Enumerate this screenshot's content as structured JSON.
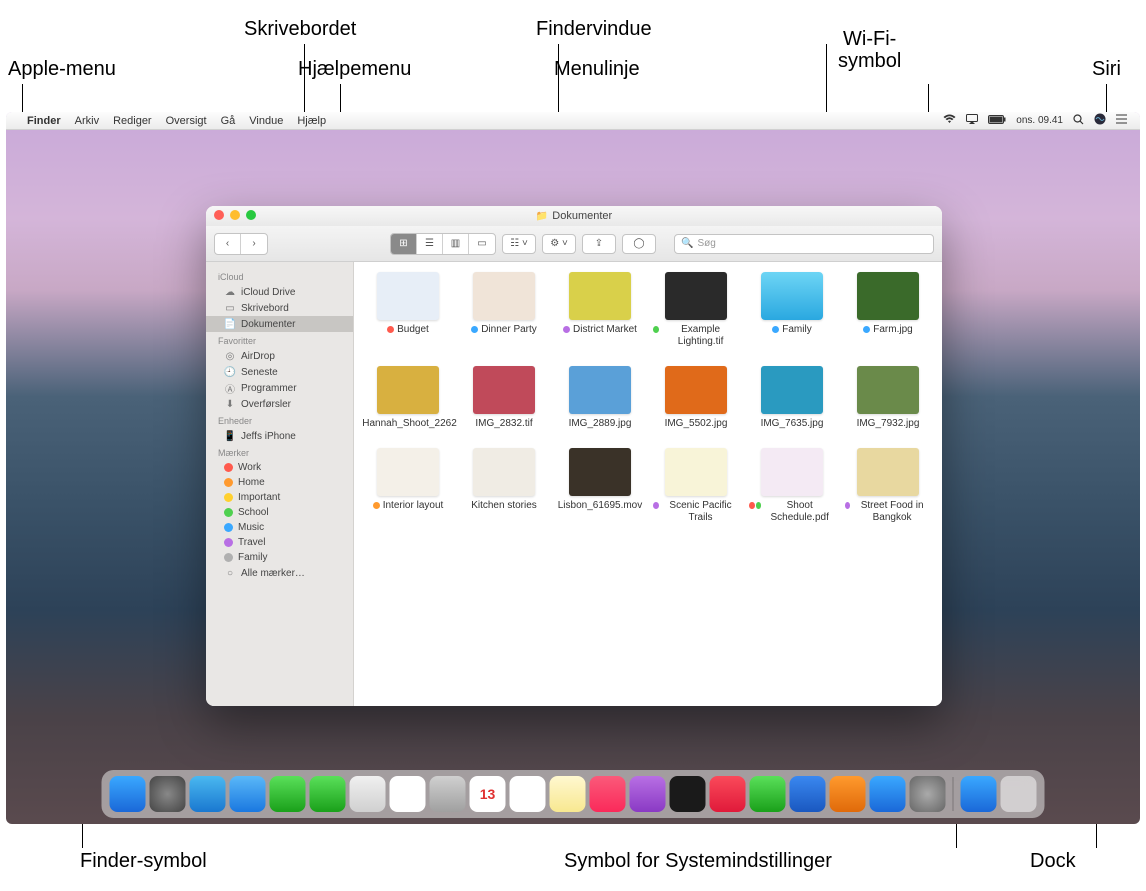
{
  "callouts": {
    "apple_menu": "Apple-menu",
    "desktop": "Skrivebordet",
    "help_menu": "Hjælpemenu",
    "finder_window": "Findervindue",
    "menu_bar": "Menulinje",
    "wifi": "Wi-Fi-\nsymbol",
    "wifi_l1": "Wi-Fi-",
    "wifi_l2": "symbol",
    "siri": "Siri",
    "finder_icon": "Finder-symbol",
    "sysprefs_icon": "Symbol for Systemindstillinger",
    "dock": "Dock"
  },
  "menubar": {
    "apple": "",
    "app": "Finder",
    "items": [
      "Arkiv",
      "Rediger",
      "Oversigt",
      "Gå",
      "Vindue",
      "Hjælp"
    ],
    "clock": "ons. 09.41"
  },
  "finder": {
    "title": "Dokumenter",
    "search_placeholder": "Søg",
    "sidebar": {
      "icloud_heading": "iCloud",
      "icloud": [
        "iCloud Drive",
        "Skrivebord",
        "Dokumenter"
      ],
      "fav_heading": "Favoritter",
      "fav": [
        "AirDrop",
        "Seneste",
        "Programmer",
        "Overførsler"
      ],
      "dev_heading": "Enheder",
      "dev": [
        "Jeffs iPhone"
      ],
      "tags_heading": "Mærker",
      "tags": [
        {
          "label": "Work",
          "color": "#ff5a4d"
        },
        {
          "label": "Home",
          "color": "#ff9a2e"
        },
        {
          "label": "Important",
          "color": "#ffd02e"
        },
        {
          "label": "School",
          "color": "#4fd04f"
        },
        {
          "label": "Music",
          "color": "#3aa8ff"
        },
        {
          "label": "Travel",
          "color": "#b86fe4"
        },
        {
          "label": "Family",
          "color": "#b0b0b0"
        }
      ],
      "all_tags": "Alle mærker…"
    },
    "files": [
      {
        "name": "Budget",
        "tag": "#ff5a4d",
        "thumb": "#e7eef7"
      },
      {
        "name": "Dinner Party",
        "tag": "#3aa8ff",
        "thumb": "#f0e4d8"
      },
      {
        "name": "District Market",
        "tag": "#b86fe4",
        "thumb": "#d9d04a"
      },
      {
        "name": "Example Lighting.tif",
        "tag": "#4fd04f",
        "thumb": "#2a2a2a"
      },
      {
        "name": "Family",
        "tag": "#3aa8ff",
        "thumb": "folder"
      },
      {
        "name": "Farm.jpg",
        "tag": "#3aa8ff",
        "thumb": "#3a6a2a"
      },
      {
        "name": "Hannah_Shoot_2262",
        "tag": "#4fd04f",
        "thumb": "#d8b040"
      },
      {
        "name": "IMG_2832.tif",
        "thumb": "#c04a5a"
      },
      {
        "name": "IMG_2889.jpg",
        "thumb": "#5aa0d8"
      },
      {
        "name": "IMG_5502.jpg",
        "thumb": "#e06a1a"
      },
      {
        "name": "IMG_7635.jpg",
        "thumb": "#2a9ac0"
      },
      {
        "name": "IMG_7932.jpg",
        "thumb": "#6a8a4a"
      },
      {
        "name": "Interior layout",
        "tag": "#ff9a2e",
        "thumb": "#f4f0e8"
      },
      {
        "name": "Kitchen stories",
        "thumb": "#f0ece4"
      },
      {
        "name": "Lisbon_61695.mov",
        "thumb": "#3a3228"
      },
      {
        "name": "Scenic Pacific Trails",
        "tag": "#b86fe4",
        "thumb": "#f8f4d8"
      },
      {
        "name": "Shoot Schedule.pdf",
        "tag": "#ff5a4d",
        "tag2": "#4fd04f",
        "thumb": "#f4eaf4"
      },
      {
        "name": "Street Food in Bangkok",
        "tag": "#b86fe4",
        "thumb": "#e8d8a0"
      }
    ]
  },
  "dock_icons": [
    {
      "name": "finder",
      "bg": "linear-gradient(#3aa8ff,#1a68d8)"
    },
    {
      "name": "launchpad",
      "bg": "radial-gradient(#888,#444)"
    },
    {
      "name": "safari",
      "bg": "linear-gradient(#4ab8f0,#1a78d0)"
    },
    {
      "name": "mail",
      "bg": "linear-gradient(#5ab8f8,#1a78e0)"
    },
    {
      "name": "facetime",
      "bg": "linear-gradient(#5ae05a,#1aa01a)"
    },
    {
      "name": "messages",
      "bg": "linear-gradient(#5ae05a,#1aa01a)"
    },
    {
      "name": "maps",
      "bg": "linear-gradient(#f0f0f0,#d0d0d0)"
    },
    {
      "name": "photos",
      "bg": "#fff"
    },
    {
      "name": "contacts",
      "bg": "linear-gradient(#d0d0d0,#a0a0a0)"
    },
    {
      "name": "calendar",
      "bg": "#fff",
      "text": "13"
    },
    {
      "name": "reminders",
      "bg": "#fff"
    },
    {
      "name": "notes",
      "bg": "linear-gradient(#fff8d0,#f8e890)"
    },
    {
      "name": "music",
      "bg": "linear-gradient(#fa5a7a,#fa2a5a)"
    },
    {
      "name": "podcasts",
      "bg": "linear-gradient(#b86fe4,#8a3ac4)"
    },
    {
      "name": "tv",
      "bg": "#1a1a1a"
    },
    {
      "name": "news",
      "bg": "linear-gradient(#fa4a5a,#e01a3a)"
    },
    {
      "name": "numbers",
      "bg": "linear-gradient(#5ae05a,#1aa01a)"
    },
    {
      "name": "keynote",
      "bg": "linear-gradient(#3a88f0,#1a58c0)"
    },
    {
      "name": "pages",
      "bg": "linear-gradient(#ff9a2e,#e06a0a)"
    },
    {
      "name": "appstore",
      "bg": "linear-gradient(#3aa8ff,#1a68d8)"
    },
    {
      "name": "systemprefs",
      "bg": "radial-gradient(#aaa,#666)"
    }
  ],
  "dock_right": [
    {
      "name": "downloads",
      "bg": "linear-gradient(#3aa8ff,#1a68d8)"
    },
    {
      "name": "trash",
      "bg": "rgba(255,255,255,0.5)"
    }
  ]
}
